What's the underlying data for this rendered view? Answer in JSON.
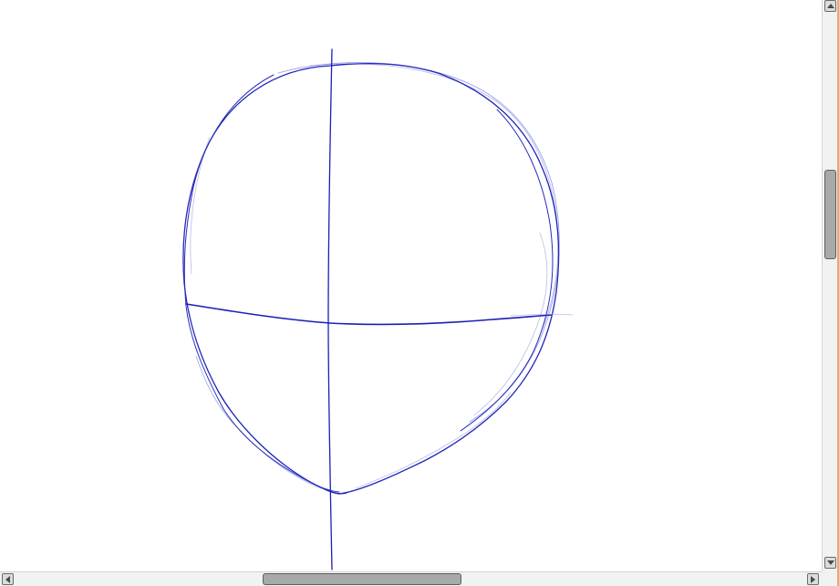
{
  "canvas": {
    "stroke_color": "#1b1fb4",
    "stroke_color_light": "#6f72d6",
    "background": "#ffffff",
    "content": "head-construction-sketch"
  },
  "scrollbars": {
    "vertical": {
      "position_fraction": 0.3,
      "visible_fraction": 0.16
    },
    "horizontal": {
      "position_fraction": 0.32,
      "visible_fraction": 0.24
    }
  },
  "icons": {
    "scroll_up": "arrow-up-icon",
    "scroll_down": "arrow-down-icon",
    "scroll_left": "arrow-left-icon",
    "scroll_right": "arrow-right-icon"
  }
}
